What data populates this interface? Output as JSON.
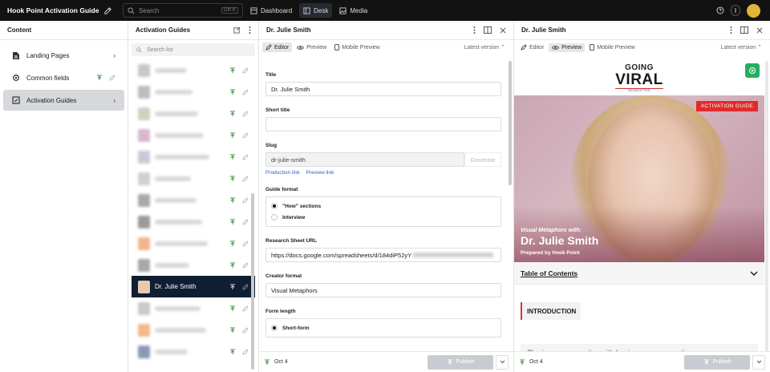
{
  "topbar": {
    "app_title": "Hook Point Activation Guide",
    "search_placeholder": "Search",
    "search_shortcut": "Ctrl K",
    "tabs": [
      {
        "label": "Dashboard",
        "active": false
      },
      {
        "label": "Desk",
        "active": true
      },
      {
        "label": "Media",
        "active": false
      }
    ]
  },
  "content_panel": {
    "title": "Content",
    "items": [
      {
        "label": "Landing Pages",
        "icon": "document-icon",
        "active": false
      },
      {
        "label": "Common fields",
        "icon": "gear-icon",
        "active": false
      },
      {
        "label": "Activation Guides",
        "icon": "checkbox-icon",
        "active": true
      }
    ]
  },
  "guides_panel": {
    "title": "Activation Guides",
    "search_placeholder": "Search list",
    "selected_label": "Dr. Julie Smith",
    "thumb_colors": [
      "#c7c7c7",
      "#bdbdbd",
      "#c9d4bf",
      "#d9b7d2",
      "#c5cbd6",
      "#d0d0d0",
      "#a9a9a9",
      "#9a9a9a",
      "#f0b58f",
      "#a8a8a8",
      "#e8c9b0",
      "#c9c9c9",
      "#f3b98a",
      "#8d97b5"
    ]
  },
  "editor": {
    "title": "Dr. Julie Smith",
    "tabs": {
      "editor": "Editor",
      "preview": "Preview",
      "mobile": "Mobile Preview"
    },
    "version": "Latest version",
    "fields": {
      "title_label": "Title",
      "title_value": "Dr. Julie Smith",
      "short_title_label": "Short title",
      "short_title_value": "",
      "slug_label": "Slug",
      "slug_value": "dr-julie-smith",
      "generate": "Generate",
      "production_link": "Production link",
      "preview_link": "Preview link",
      "guide_format_label": "Guide format",
      "guide_format_opt1": "\"How\" sections",
      "guide_format_opt2": "Interview",
      "research_label": "Research Sheet URL",
      "research_value": "https://docs.google.com/spreadsheets/d/184diP52yY",
      "creator_label": "Creator format",
      "creator_value": "Visual Metaphors",
      "form_length_label": "Form length",
      "form_length_opt1": "Short-form"
    },
    "footer_date": "Oct 4",
    "publish": "Publish"
  },
  "preview": {
    "title": "Dr. Julie Smith",
    "tabs": {
      "editor": "Editor",
      "preview": "Preview",
      "mobile": "Mobile Preview"
    },
    "version": "Latest version",
    "logo_line1": "GOING",
    "logo_line2": "VIRAL",
    "logo_line3": "NEWSLETTER",
    "badge": "ACTIVATION GUIDE",
    "hero_pre": "Visual Metaphors with:",
    "hero_name": "Dr. Julie Smith",
    "hero_by": "Prepared by Hook Point",
    "toc": "Table of Contents",
    "intro": "INTRODUCTION",
    "cut_text": "Sharing your expertise with beginners can sometimes",
    "footer_date": "Oct 4",
    "publish": "Publish"
  }
}
